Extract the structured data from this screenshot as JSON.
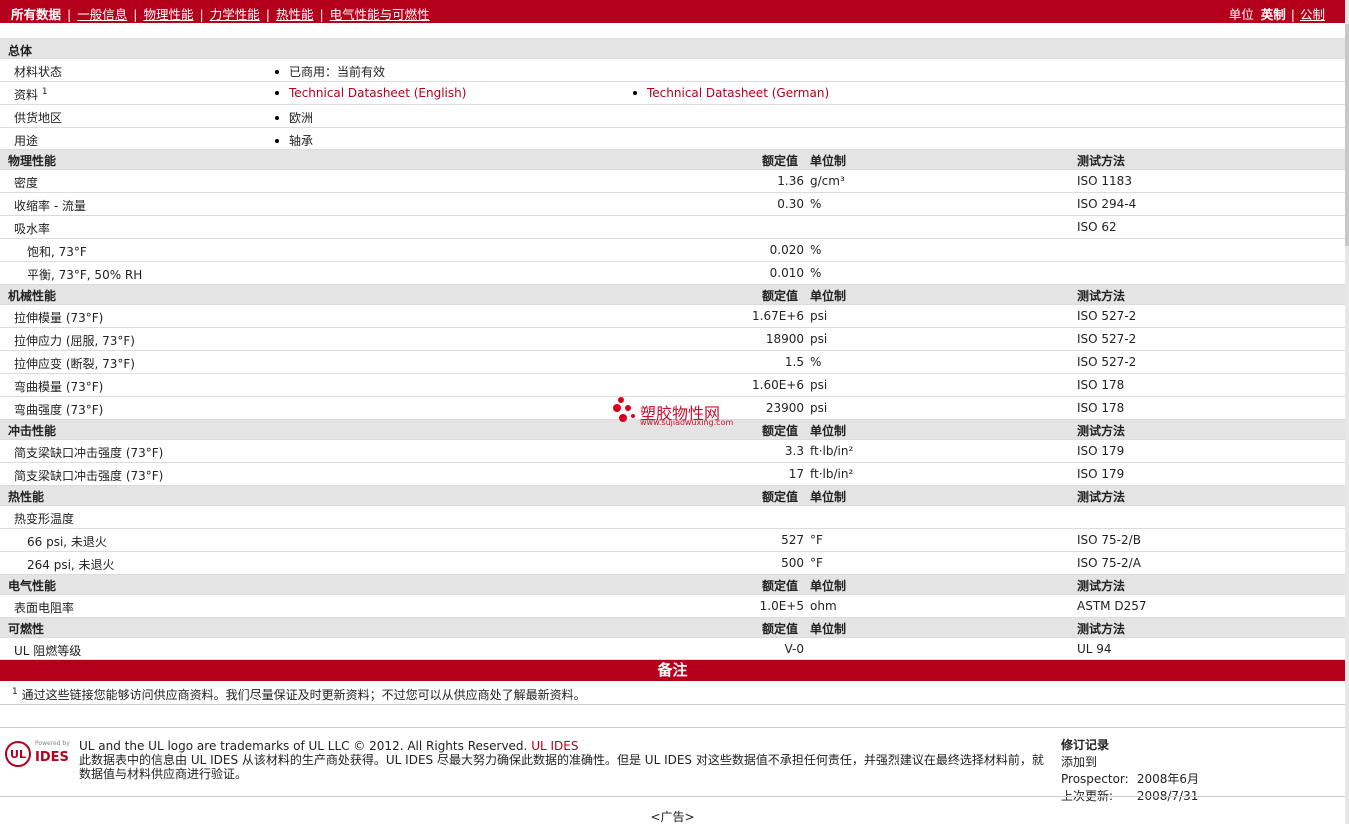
{
  "nav": {
    "items": [
      "所有数据",
      "一般信息",
      "物理性能",
      "力学性能",
      "热性能",
      "电气性能与可燃性"
    ],
    "units_label": "单位",
    "unit_english": "英制",
    "unit_metric": "公制"
  },
  "general": {
    "title": "总体",
    "rows": [
      {
        "name": "材料状态",
        "value": "已商用：当前有效"
      },
      {
        "name": "资料",
        "footnote": "1",
        "link1": "Technical Datasheet (English)",
        "link2": "Technical Datasheet (German)"
      },
      {
        "name": "供货地区",
        "value": "欧洲"
      },
      {
        "name": "用途",
        "value": "轴承"
      }
    ]
  },
  "col_headers": {
    "rated": "额定值",
    "unit": "单位制",
    "test": "测试方法"
  },
  "sections": {
    "physical": {
      "title": "物理性能",
      "rows": [
        {
          "name": "密度",
          "value": "1.36",
          "unit": "g/cm³",
          "test": "ISO 1183"
        },
        {
          "name": "收缩率  - 流量",
          "value": "0.30",
          "unit": "%",
          "test": "ISO 294-4"
        },
        {
          "name": "吸水率",
          "value": "",
          "unit": "",
          "test": "ISO 62"
        },
        {
          "name": "饱和, 73°F",
          "value": "0.020",
          "unit": "%",
          "test": ""
        },
        {
          "name": "平衡, 73°F, 50% RH",
          "value": "0.010",
          "unit": "%",
          "test": ""
        }
      ]
    },
    "mechanical": {
      "title": "机械性能",
      "rows": [
        {
          "name": "拉伸模量  (73°F)",
          "value": "1.67E+6",
          "unit": "psi",
          "test": "ISO 527-2"
        },
        {
          "name": "拉伸应力  (屈服, 73°F)",
          "value": "18900",
          "unit": "psi",
          "test": "ISO 527-2"
        },
        {
          "name": "拉伸应变  (断裂, 73°F)",
          "value": "1.5",
          "unit": "%",
          "test": "ISO 527-2"
        },
        {
          "name": "弯曲模量  (73°F)",
          "value": "1.60E+6",
          "unit": "psi",
          "test": "ISO 178"
        },
        {
          "name": "弯曲强度  (73°F)",
          "value": "23900",
          "unit": "psi",
          "test": "ISO 178"
        }
      ]
    },
    "impact": {
      "title": "冲击性能",
      "rows": [
        {
          "name": "简支梁缺口冲击强度  (73°F)",
          "value": "3.3",
          "unit": "ft·lb/in²",
          "test": "ISO 179"
        },
        {
          "name": "简支梁缺口冲击强度  (73°F)",
          "value": "17",
          "unit": "ft·lb/in²",
          "test": "ISO 179"
        }
      ]
    },
    "thermal": {
      "title": "热性能",
      "rows": [
        {
          "name": "热变形温度",
          "value": "",
          "unit": "",
          "test": ""
        },
        {
          "name": "66 psi, 未退火",
          "value": "527",
          "unit": "°F",
          "test": "ISO 75-2/B"
        },
        {
          "name": "264 psi, 未退火",
          "value": "500",
          "unit": "°F",
          "test": "ISO 75-2/A"
        }
      ]
    },
    "electrical": {
      "title": "电气性能",
      "rows": [
        {
          "name": "表面电阻率",
          "value": "1.0E+5",
          "unit": "ohm",
          "test": "ASTM D257"
        }
      ]
    },
    "flammability": {
      "title": "可燃性",
      "rows": [
        {
          "name": "UL 阻燃等级",
          "value": "V-0",
          "unit": "",
          "test": "UL 94"
        }
      ]
    }
  },
  "notes": {
    "title": "备注",
    "footnote_num": "1",
    "text": "通过这些链接您能够访问供应商资料。我们尽量保证及时更新资料；不过您可以从供应商处了解最新资料。"
  },
  "footer": {
    "logo_powered": "Powered by",
    "logo_text": "IDES",
    "logo_ul": "UL",
    "trademark": "UL and the UL logo are trademarks of UL LLC © 2012. All Rights Reserved.",
    "trademark_link": "UL IDES",
    "disclaimer": "此数据表中的信息由  UL IDES 从该材料的生产商处获得。UL IDES 尽最大努力确保此数据的准确性。但是  UL IDES 对这些数据值不承担任何责任，并强烈建议在最终选择材料前，就数据值与材料供应商进行验证。",
    "revision_title": "修订记录",
    "added_label": "添加到  Prospector:",
    "added_value": "2008年6月",
    "updated_label": "上次更新:",
    "updated_value": "2008/7/31"
  },
  "ad": "<广告>",
  "watermark": {
    "text": "塑胶物性网",
    "url": "www.sujiaowuxing.com"
  },
  "colors": {
    "brand": "#b5001b",
    "header_bg": "#e4e4e4"
  }
}
